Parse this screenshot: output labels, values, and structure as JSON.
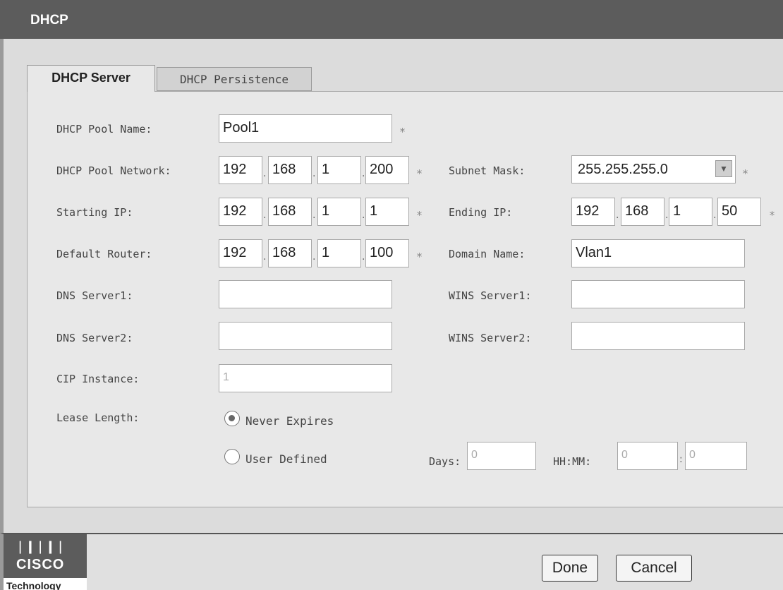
{
  "window": {
    "title": "DHCP"
  },
  "tabs": [
    {
      "label": "DHCP Server",
      "active": true
    },
    {
      "label": "DHCP Persistence",
      "active": false
    }
  ],
  "form": {
    "pool_name": {
      "label": "DHCP Pool Name:",
      "value": "Pool1"
    },
    "pool_network": {
      "label": "DHCP Pool Network:",
      "octets": [
        "192",
        "168",
        "1",
        "200"
      ]
    },
    "subnet_mask": {
      "label": "Subnet Mask:",
      "value": "255.255.255.0"
    },
    "starting_ip": {
      "label": "Starting IP:",
      "octets": [
        "192",
        "168",
        "1",
        "1"
      ]
    },
    "ending_ip": {
      "label": "Ending IP:",
      "octets": [
        "192",
        "168",
        "1",
        "50"
      ]
    },
    "default_router": {
      "label": "Default Router:",
      "octets": [
        "192",
        "168",
        "1",
        "100"
      ]
    },
    "domain_name": {
      "label": "Domain Name:",
      "value": "Vlan1"
    },
    "dns_server1": {
      "label": "DNS Server1:",
      "value": ""
    },
    "wins_server1": {
      "label": "WINS Server1:",
      "value": ""
    },
    "dns_server2": {
      "label": "DNS Server2:",
      "value": ""
    },
    "wins_server2": {
      "label": "WINS Server2:",
      "value": ""
    },
    "cip_instance": {
      "label": "CIP Instance:",
      "value": "1"
    },
    "lease_length": {
      "label": "Lease Length:",
      "never_expires": "Never Expires",
      "user_defined": "User Defined",
      "selected": "never_expires",
      "days_label": "Days:",
      "days_value": "0",
      "hhmm_label": "HH:MM:",
      "hh_value": "0",
      "mm_value": "0"
    },
    "required_mark": "*",
    "octet_separator": ".",
    "time_separator": ":"
  },
  "footer": {
    "logo_word": "CISCO",
    "logo_tagline": "Technology",
    "done_label": "Done",
    "cancel_label": "Cancel"
  },
  "colors": {
    "titlebar": "#5c5c5c",
    "panel": "#e8e8e8",
    "background": "#dcdcdc"
  },
  "icons": {
    "select_arrow": "chevron-down-icon",
    "logo": "cisco-logo-icon"
  }
}
